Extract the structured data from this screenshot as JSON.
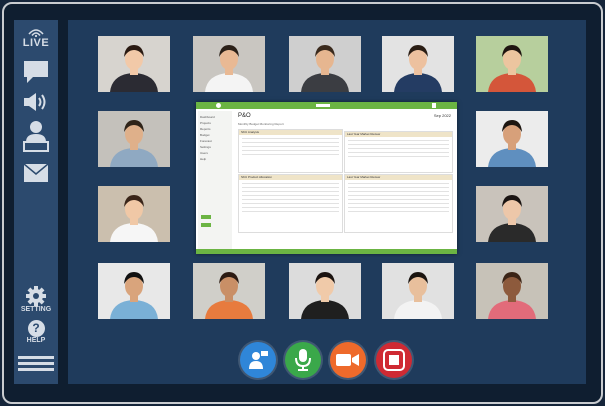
{
  "sidebar": {
    "live_label": "LIVE",
    "setting_label": "SETTING",
    "help_label": "HELP",
    "help_glyph": "?",
    "icons": [
      "live-wifi-icon",
      "chat-icon",
      "speaker-icon",
      "presenter-icon",
      "mail-icon",
      "gear-icon",
      "help-icon",
      "menu-icon"
    ]
  },
  "participants": [
    {
      "id": "p1",
      "skin": "#f2c9a8",
      "hair": "#2a1a12",
      "shirt": "#2b2b33",
      "bg": "#d7d4cf"
    },
    {
      "id": "p2",
      "skin": "#e9b994",
      "hair": "#2b2018",
      "shirt": "#f4f4f4",
      "bg": "#c9c6c1"
    },
    {
      "id": "p3",
      "skin": "#e6b690",
      "hair": "#3a2a1d",
      "shirt": "#3b3d42",
      "bg": "#cfcfcf"
    },
    {
      "id": "p4",
      "skin": "#edc19f",
      "hair": "#2a1d14",
      "shirt": "#243c63",
      "bg": "#e3e3e3"
    },
    {
      "id": "p5",
      "skin": "#ecc59f",
      "hair": "#1e1510",
      "shirt": "#d4563a",
      "bg": "#b7cf9d"
    },
    {
      "id": "p6",
      "skin": "#dfb08a",
      "hair": "#2f2419",
      "shirt": "#8fa9c2",
      "bg": "#c4c1bb"
    },
    {
      "id": "p7",
      "skin": "#d7a07a",
      "hair": "#1d1611",
      "shirt": "#5f8fbf",
      "bg": "#ececec"
    },
    {
      "id": "p8",
      "skin": "#f0c8a6",
      "hair": "#3a2519",
      "shirt": "#f6f6f6",
      "bg": "#cbbfae"
    },
    {
      "id": "p9",
      "skin": "#edc7a9",
      "hair": "#1a1412",
      "shirt": "#2a2a2a",
      "bg": "#c9c3bb"
    },
    {
      "id": "p10",
      "skin": "#d9a47c",
      "hair": "#111111",
      "shirt": "#7ab0d6",
      "bg": "#e8e8e8"
    },
    {
      "id": "p11",
      "skin": "#c98f66",
      "hair": "#2c1b12",
      "shirt": "#e77b3e",
      "bg": "#d0cfc9"
    },
    {
      "id": "p12",
      "skin": "#f0caa9",
      "hair": "#1b1310",
      "shirt": "#1f1f1f",
      "bg": "#dcdcdc"
    },
    {
      "id": "p13",
      "skin": "#e8bf9c",
      "hair": "#1a1410",
      "shirt": "#f3f3f3",
      "bg": "#e1e1e1"
    },
    {
      "id": "p14",
      "skin": "#8d5a3c",
      "hair": "#3b2416",
      "shirt": "#e26b7a",
      "bg": "#c7c2b8"
    }
  ],
  "shared_screen": {
    "title": "P&O",
    "date": "Sep 2022",
    "intro": "Monthly Budget Monitoring Report",
    "nav_items": [
      "Dashboard",
      "Projects",
      "Reports",
      "Budget",
      "Forecast",
      "Settings",
      "Users",
      "Help"
    ],
    "panels": {
      "tl": "SKU Analysis",
      "bl": "SKU Product Allocation",
      "tr": "Last Year Market Review",
      "br": "Last Year Market Review"
    }
  },
  "controls": [
    {
      "id": "share",
      "icon": "share-screen-icon",
      "color": "#2f86d8"
    },
    {
      "id": "mic",
      "icon": "microphone-icon",
      "color": "#3aa84a"
    },
    {
      "id": "camera",
      "icon": "video-camera-icon",
      "color": "#ee6a2b"
    },
    {
      "id": "stop",
      "icon": "stop-record-icon",
      "color": "#cf2a33"
    }
  ]
}
